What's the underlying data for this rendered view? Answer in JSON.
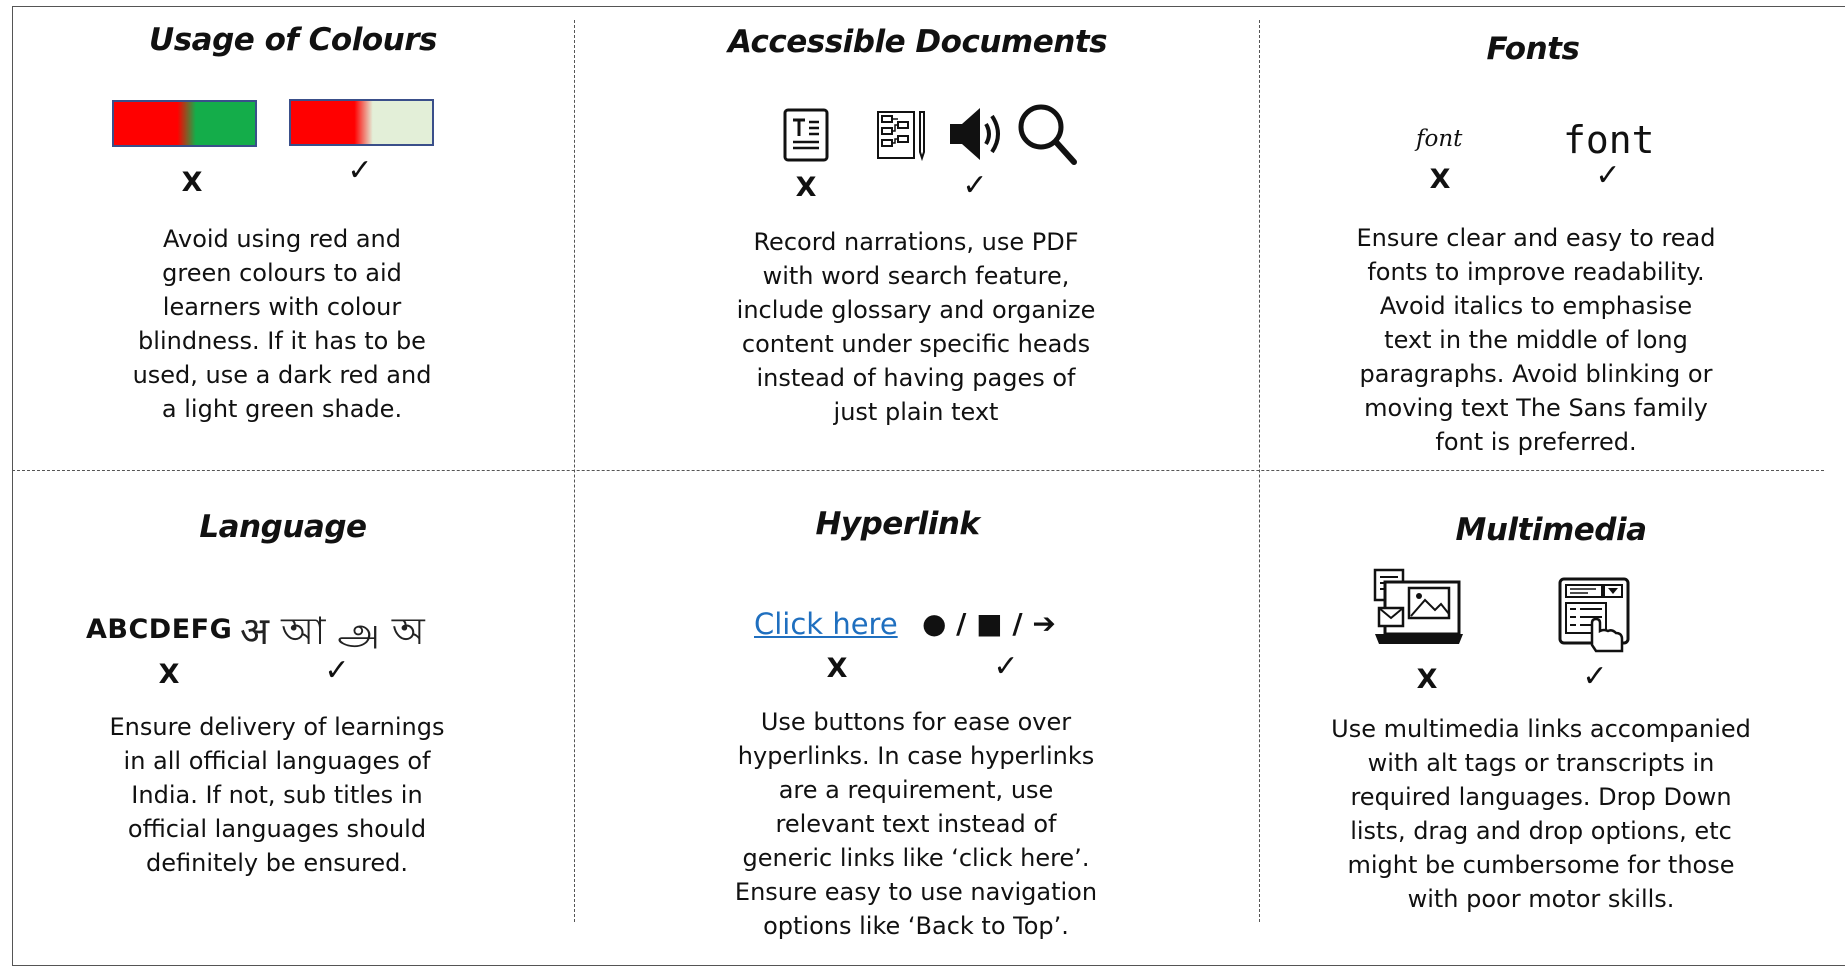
{
  "colours": {
    "title": "Usage of Colours",
    "bad_mark": "X",
    "good_mark": "✓",
    "text": "Avoid using red and\ngreen colours to aid\nlearners with colour\nblindness. If it has to be\nused, use a dark red and\na light green shade."
  },
  "documents": {
    "title": "Accessible Documents",
    "bad_mark": "X",
    "good_mark": "✓",
    "text": "Record narrations, use PDF\nwith word search feature,\ninclude glossary and organize\ncontent under specific heads\ninstead of having pages of\njust plain text"
  },
  "fonts": {
    "title": "Fonts",
    "bad_sample": "font",
    "good_sample": "font",
    "bad_mark": "X",
    "good_mark": "✓",
    "text": "Ensure clear and easy to read\nfonts to improve readability.\nAvoid italics to emphasise\ntext in the middle of long\nparagraphs. Avoid blinking or\nmoving text The Sans family\nfont is preferred."
  },
  "language": {
    "title": "Language",
    "bad_sample": "ABCDEFG",
    "good_sample": "अ আ அ অ",
    "bad_mark": "X",
    "good_mark": "✓",
    "text": "Ensure delivery of learnings\nin all official languages of\nIndia. If not, sub titles in\nofficial languages should\ndefinitely be ensured."
  },
  "hyperlink": {
    "title": "Hyperlink",
    "bad_sample": "Click here",
    "good_sample": "● / ■ / ➔",
    "bad_mark": "X",
    "good_mark": "✓",
    "text": "Use buttons for ease over\nhyperlinks. In case hyperlinks\nare a requirement, use\nrelevant text instead of\ngeneric links like ‘click here’.\nEnsure easy to use navigation\noptions like ‘Back to Top’."
  },
  "multimedia": {
    "title": "Multimedia",
    "bad_mark": "X",
    "good_mark": "✓",
    "text": "Use multimedia links accompanied\nwith alt tags or transcripts in\nrequired languages. Drop Down\nlists, drag and drop options, etc\nmight be cumbersome for those\nwith poor motor skills."
  },
  "colors": {
    "red": "#ff0000",
    "green": "#14ad4a",
    "light_green": "#e3efd8",
    "link_blue": "#1f6fbf"
  }
}
